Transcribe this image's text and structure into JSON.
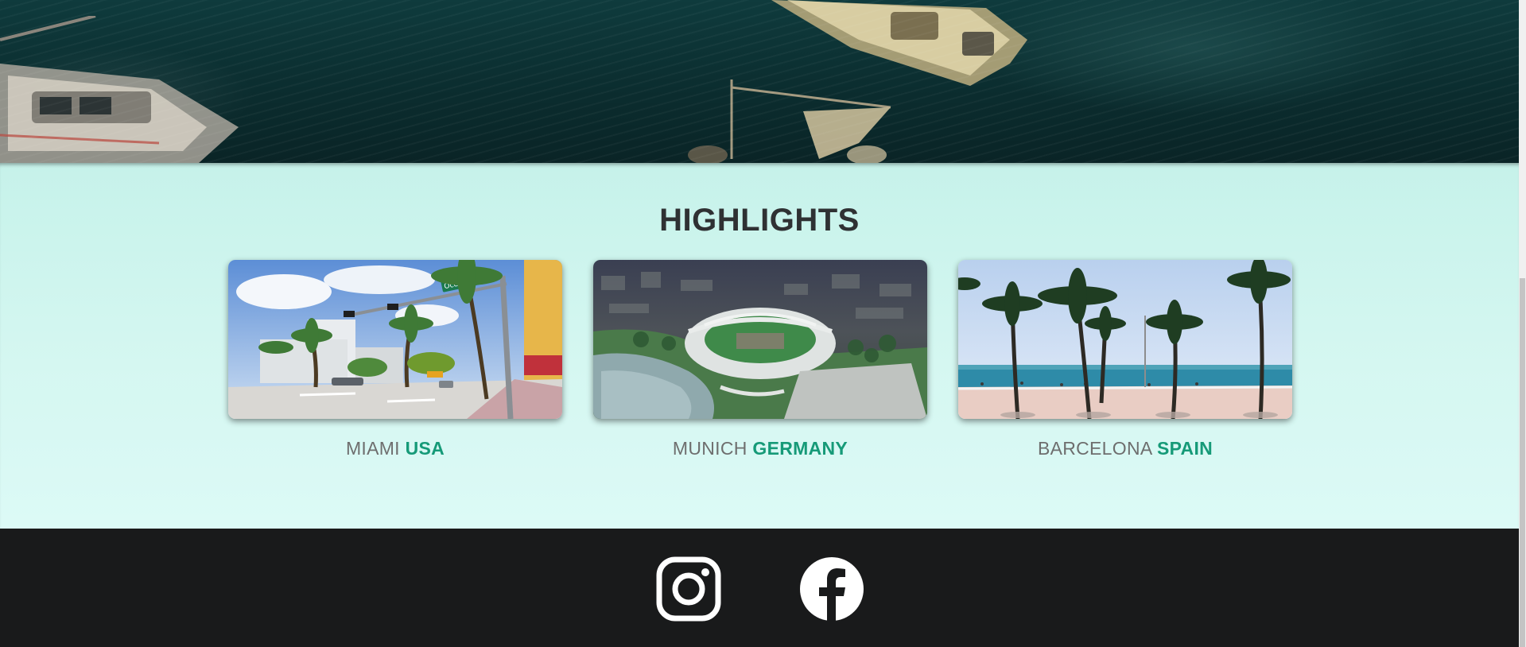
{
  "highlights": {
    "title": "HIGHLIGHTS",
    "cards": [
      {
        "city": "MIAMI",
        "country": "USA",
        "image": "miami-ocean-drive-street-photo",
        "sign_text": "Ocean Dr"
      },
      {
        "city": "MUNICH",
        "country": "GERMANY",
        "image": "munich-olympic-stadium-aerial-photo"
      },
      {
        "city": "BARCELONA",
        "country": "SPAIN",
        "image": "barcelona-beach-palm-trees-photo"
      }
    ]
  },
  "footer": {
    "social": [
      {
        "icon": "instagram-icon"
      },
      {
        "icon": "facebook-icon"
      }
    ]
  },
  "colors": {
    "section_bg": "#d5f7f1",
    "country_accent": "#169a78",
    "city_text": "#6e6e6e",
    "footer_bg": "#191a1b",
    "title_text": "#2f3133"
  }
}
